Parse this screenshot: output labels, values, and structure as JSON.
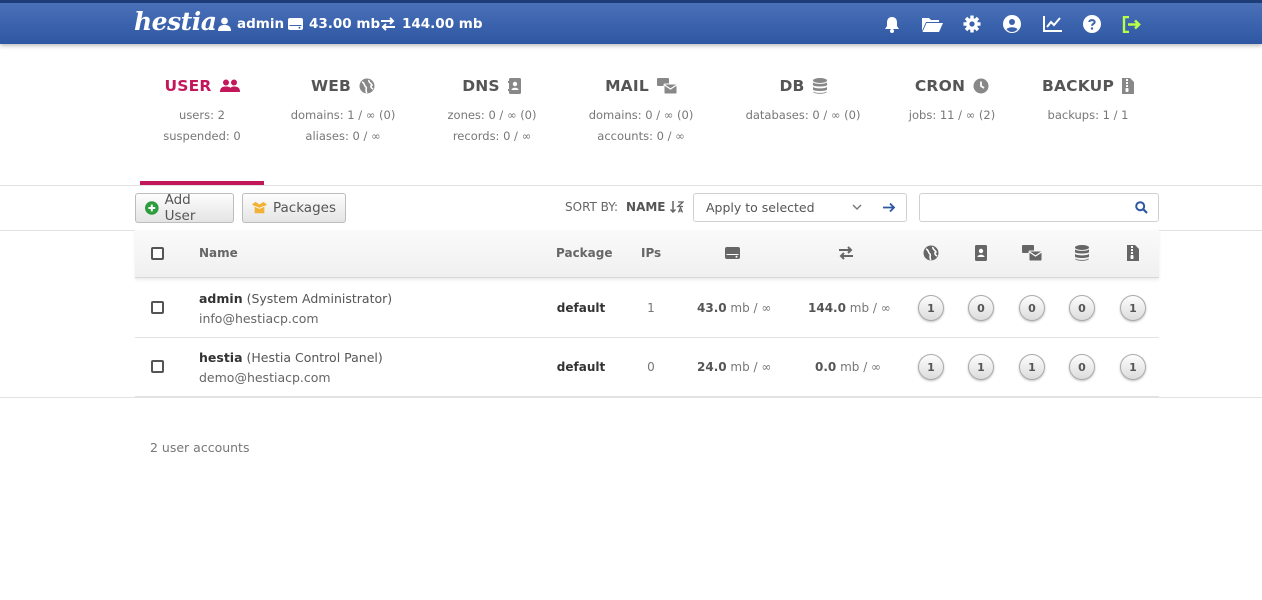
{
  "app": {
    "logo_text": "hestia"
  },
  "topbar": {
    "username": "admin",
    "disk": "43.00 mb",
    "bandwidth": "144.00 mb",
    "icons": [
      "bell-icon",
      "folder-open-icon",
      "gear-icon",
      "user-circle-icon",
      "chart-line-icon",
      "question-circle-icon",
      "logout-icon"
    ],
    "logout_color": "#b8ff4a"
  },
  "colors": {
    "accent": "#c2185b",
    "topbar": "#3a62ad",
    "add_green": "#2e9d3e",
    "package_orange": "#f2b236"
  },
  "tabs": [
    {
      "label": "USER",
      "icon": "users-icon",
      "stats": [
        "users: 2",
        "suspended: 0"
      ],
      "active": true
    },
    {
      "label": "WEB",
      "icon": "globe-icon",
      "stats": [
        "domains: 1 / ∞ (0)",
        "aliases: 0 / ∞"
      ]
    },
    {
      "label": "DNS",
      "icon": "address-book-icon",
      "stats": [
        "zones: 0 / ∞ (0)",
        "records: 0 / ∞"
      ]
    },
    {
      "label": "MAIL",
      "icon": "mail-bulk-icon",
      "stats": [
        "domains: 0 / ∞ (0)",
        "accounts: 0 / ∞"
      ]
    },
    {
      "label": "DB",
      "icon": "database-icon",
      "stats": [
        "databases: 0 / ∞ (0)"
      ]
    },
    {
      "label": "CRON",
      "icon": "clock-icon",
      "stats": [
        "jobs: 11 / ∞ (2)"
      ]
    },
    {
      "label": "BACKUP",
      "icon": "file-archive-icon",
      "stats": [
        "backups: 1 / 1"
      ]
    }
  ],
  "toolbar": {
    "add_user": "Add User",
    "packages": "Packages",
    "sort_by": "SORT BY:",
    "sort_field": "NAME",
    "bulk_action": "Apply to selected",
    "search_placeholder": ""
  },
  "table": {
    "headers": {
      "name": "Name",
      "package": "Package",
      "ips": "IPs"
    },
    "header_icons": [
      "hdd-icon",
      "exchange-icon",
      "globe-icon",
      "address-book-icon",
      "mail-bulk-icon",
      "database-icon",
      "file-archive-icon"
    ],
    "rows": [
      {
        "user": "admin",
        "fullname": "(System Administrator)",
        "email": "info@hestiacp.com",
        "package": "default",
        "ips": "1",
        "disk_value": "43.0",
        "disk_rest": " mb / ∞",
        "bw_value": "144.0",
        "bw_rest": " mb / ∞",
        "counts": [
          "1",
          "0",
          "0",
          "0",
          "1"
        ]
      },
      {
        "user": "hestia",
        "fullname": "(Hestia Control Panel)",
        "email": "demo@hestiacp.com",
        "package": "default",
        "ips": "0",
        "disk_value": "24.0",
        "disk_rest": " mb / ∞",
        "bw_value": "0.0",
        "bw_rest": " mb / ∞",
        "counts": [
          "1",
          "1",
          "1",
          "0",
          "1"
        ]
      }
    ]
  },
  "footer": {
    "summary": "2 user accounts"
  }
}
